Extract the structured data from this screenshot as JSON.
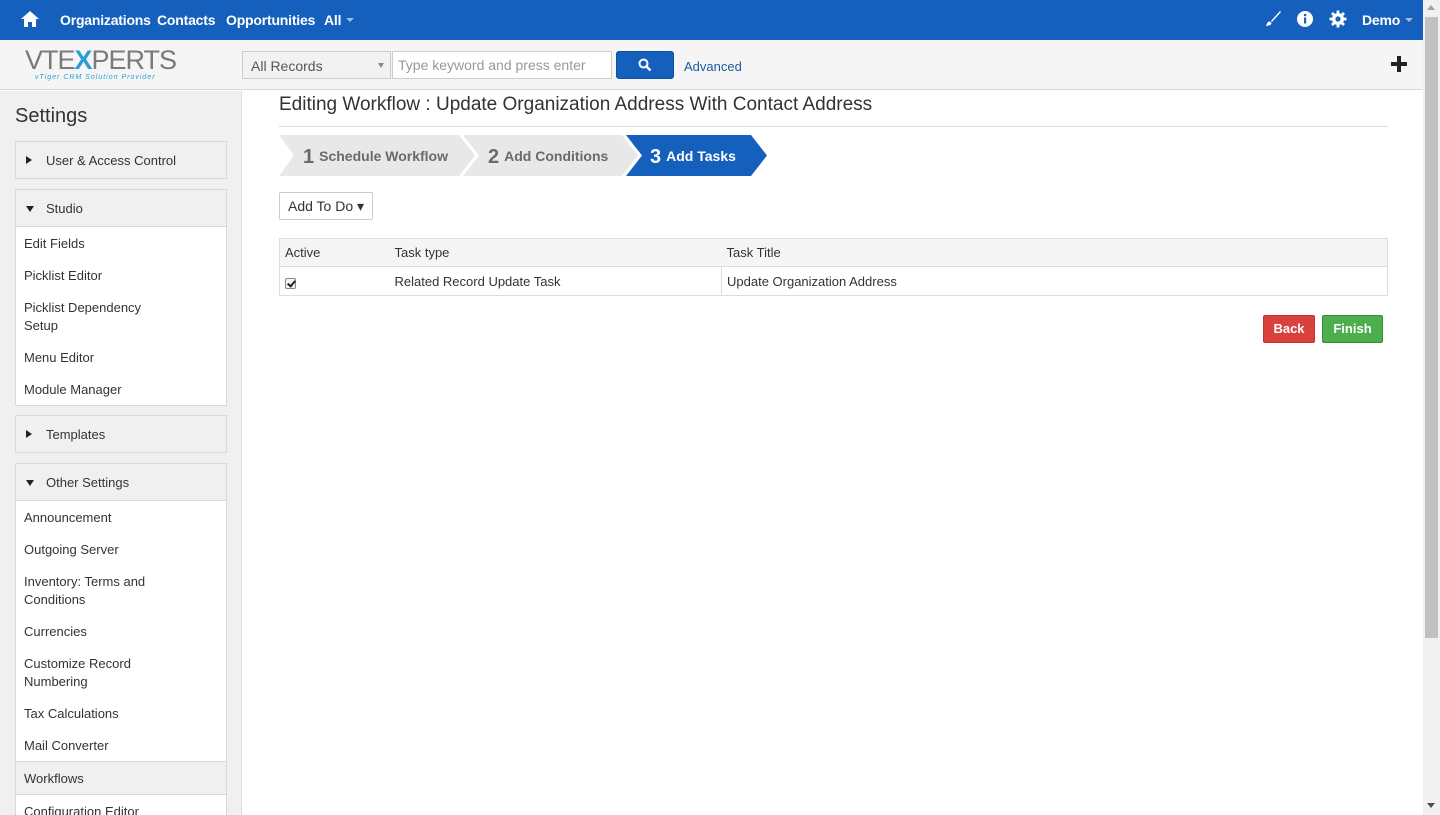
{
  "topnav": {
    "links": [
      "Organizations",
      "Contacts",
      "Opportunities",
      "All"
    ],
    "user": "Demo"
  },
  "header": {
    "logo_text": "VTEXPERTS",
    "logo_tagline": "vTiger CRM Solution Provider",
    "record_select": "All Records",
    "search_placeholder": "Type keyword and press enter",
    "advanced_label": "Advanced"
  },
  "sidebar": {
    "title": "Settings",
    "blocks": [
      {
        "label": "User & Access Control",
        "expanded": false,
        "items": []
      },
      {
        "label": "Studio",
        "expanded": true,
        "items": [
          "Edit Fields",
          "Picklist Editor",
          "Picklist Dependency Setup",
          "Menu Editor",
          "Module Manager"
        ]
      },
      {
        "label": "Templates",
        "expanded": false,
        "items": []
      },
      {
        "label": "Other Settings",
        "expanded": true,
        "items": [
          "Announcement",
          "Outgoing Server",
          "Inventory: Terms and Conditions",
          "Currencies",
          "Customize Record Numbering",
          "Tax Calculations",
          "Mail Converter",
          "Workflows",
          "Configuration Editor"
        ],
        "active": "Workflows"
      }
    ]
  },
  "main": {
    "title": "Editing Workflow : Update Organization Address With Contact Address",
    "steps": [
      {
        "num": "1",
        "label": "Schedule Workflow"
      },
      {
        "num": "2",
        "label": "Add Conditions"
      },
      {
        "num": "3",
        "label": "Add Tasks"
      }
    ],
    "active_step": 3,
    "add_button": "Add To Do ▾",
    "table": {
      "headers": [
        "Active",
        "Task type",
        "Task Title"
      ],
      "rows": [
        {
          "active": true,
          "type": "Related Record Update Task",
          "title": "Update Organization Address"
        }
      ]
    },
    "back_label": "Back",
    "finish_label": "Finish"
  },
  "colors": {
    "nav_blue": "#1560bd",
    "back_red": "#d9413e",
    "finish_green": "#4cae4c"
  }
}
